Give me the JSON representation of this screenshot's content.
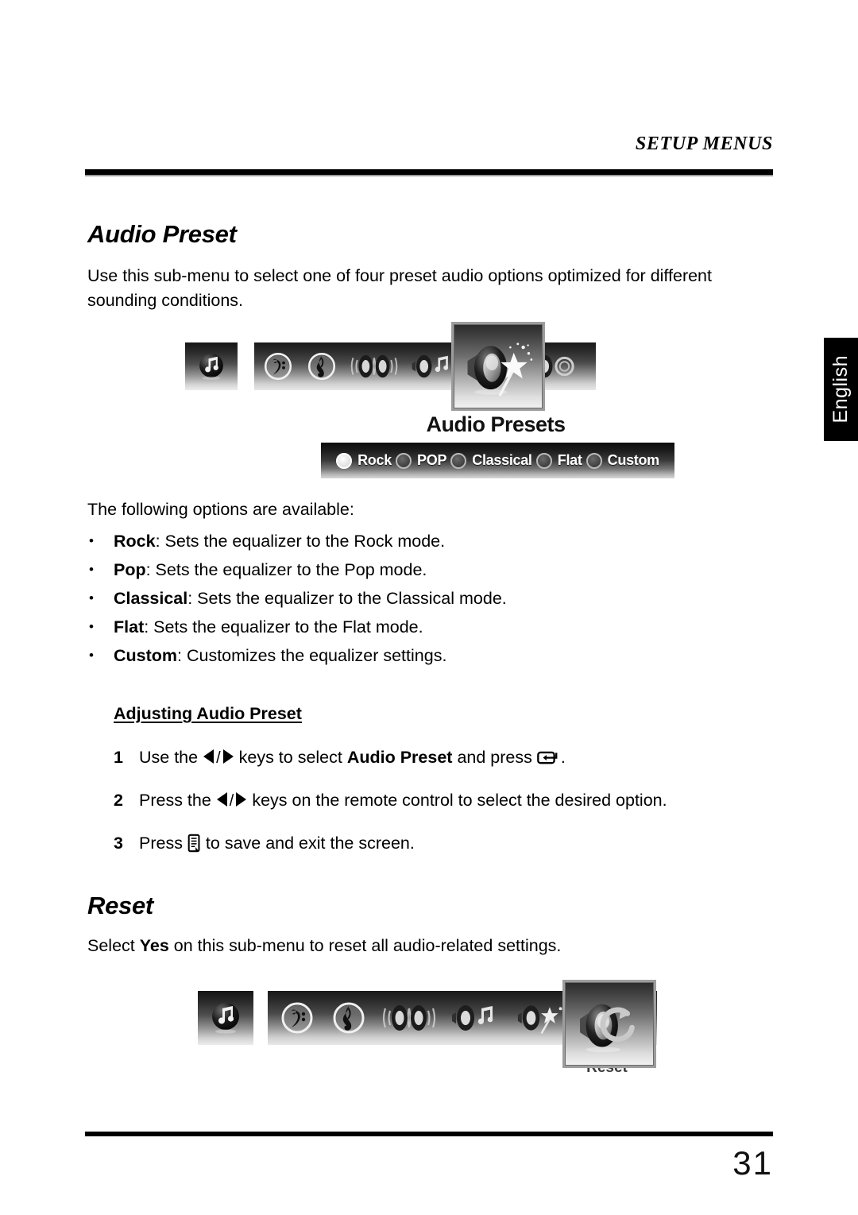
{
  "header": {
    "running_title": "SETUP MENUS"
  },
  "side_tab": {
    "label": "English"
  },
  "sections": [
    {
      "heading": "Audio Preset",
      "intro": "Use this sub-menu to select one of four preset audio options optimized for different sounding conditions."
    },
    {
      "heading": "Reset",
      "intro_parts": {
        "before": "Select ",
        "bold": "Yes",
        "after": " on this sub-menu to reset all audio-related settings."
      }
    }
  ],
  "osd_audio_presets": {
    "category_icon": "music-note-icon",
    "strip_icons": [
      "bass-clef-icon",
      "treble-clef-icon",
      "dual-speaker-icon",
      "speaker-music-note-icon",
      "speaker-loop-icon"
    ],
    "selected_icon": "speaker-magic-wand-icon",
    "title": "Audio Presets",
    "options": [
      {
        "label": "Rock",
        "selected": true
      },
      {
        "label": "POP",
        "selected": false
      },
      {
        "label": "Classical",
        "selected": false
      },
      {
        "label": "Flat",
        "selected": false
      },
      {
        "label": "Custom",
        "selected": false
      }
    ]
  },
  "osd_reset": {
    "category_icon": "music-note-icon",
    "strip_icons": [
      "bass-clef-icon",
      "treble-clef-icon",
      "dual-speaker-icon",
      "speaker-music-note-icon",
      "speaker-magic-wand-icon"
    ],
    "selected_icon": "speaker-reset-loop-icon",
    "title": "Reset"
  },
  "options_intro": "The following options are available:",
  "bullets": [
    {
      "bullet": "•",
      "term": "Rock",
      "desc": ": Sets the equalizer to the Rock mode."
    },
    {
      "bullet": "•",
      "term": "Pop",
      "desc": ": Sets the equalizer to the Pop mode."
    },
    {
      "bullet": "•",
      "term": "Classical",
      "desc": ": Sets the equalizer to the Classical mode."
    },
    {
      "bullet": "•",
      "term": "Flat",
      "desc": ": Sets the equalizer to the Flat mode."
    },
    {
      "bullet": "•",
      "term": "Custom",
      "desc": ": Customizes the equalizer settings."
    }
  ],
  "procedure": {
    "title": "Adjusting Audio Preset",
    "steps": [
      {
        "num": "1",
        "p1": "Use the ",
        "sep": "/",
        "p2": " keys to select ",
        "bold": "Audio Preset",
        "p3": " and press ",
        "p4": "."
      },
      {
        "num": "2",
        "p1": "Press the ",
        "sep": "/",
        "p2": " keys on the remote control to select the desired option.",
        "bold": "",
        "p3": "",
        "p4": ""
      },
      {
        "num": "3",
        "p1": "Press ",
        "p2": " to save and exit the screen."
      }
    ]
  },
  "footer": {
    "page_number": "31"
  }
}
